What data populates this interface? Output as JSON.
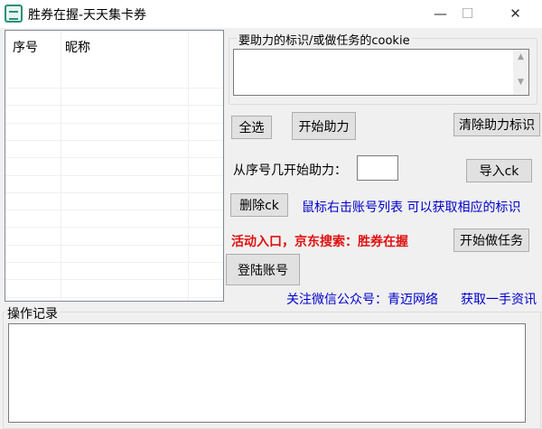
{
  "window": {
    "title": "胜券在握-天天集卡券",
    "minimize": "—",
    "maximize": "☐",
    "close": "✕"
  },
  "list": {
    "columns": [
      "序号",
      "昵称",
      ""
    ]
  },
  "cookie_group": {
    "label": "要助力的标识/或做任务的cookie",
    "value": ""
  },
  "buttons": {
    "select_all": "全选",
    "start_help": "开始助力",
    "clear_help": "清除助力标识",
    "import_ck": "导入ck",
    "delete_ck": "删除ck",
    "start_task": "开始做任务",
    "login": "登陆账号"
  },
  "start_from": {
    "label": "从序号几开始助力：",
    "value": ""
  },
  "hint": "鼠标右击账号列表  可以获取相应的标识",
  "activity": "活动入口，京东搜索：胜券在握",
  "follow": "关注微信公众号：青迈网络",
  "news": "获取一手资讯",
  "log": {
    "label": "操作记录",
    "value": ""
  }
}
